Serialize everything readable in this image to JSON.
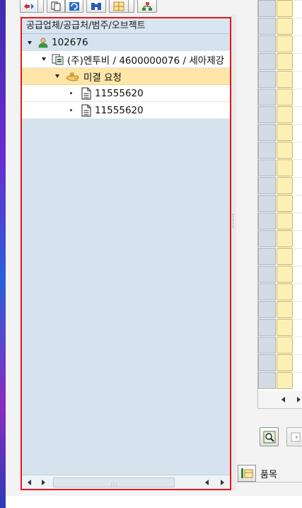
{
  "toolbar": {
    "buttons": [
      "assign-icon",
      "copy-icon",
      "refresh-icon",
      "binoculars-icon",
      "layout-icon",
      "hierarchy-icon"
    ]
  },
  "tree": {
    "header": "공급업체/공급처/범주/오브젝트",
    "nodes": [
      {
        "label": "102676",
        "icon": "person-icon",
        "level": 0,
        "expanded": true
      },
      {
        "label": "(주)엔투비 / 4600000076 / 세아제강",
        "icon": "document-tree-icon",
        "level": 1,
        "expanded": true
      },
      {
        "label": "미결 요청",
        "icon": "open-hand-icon",
        "level": 2,
        "expanded": true,
        "selected": true
      },
      {
        "label": "11555620",
        "icon": "document-icon",
        "level": 3
      },
      {
        "label": "11555620",
        "icon": "document-icon",
        "level": 3
      }
    ]
  },
  "right_panel": {
    "items_label": "품목"
  },
  "colors": {
    "selection_border": "#e8161b",
    "tree_background": "#d6e3ef",
    "selected_row": "#fde6a8",
    "grid_cell": "#fdf0b4"
  }
}
